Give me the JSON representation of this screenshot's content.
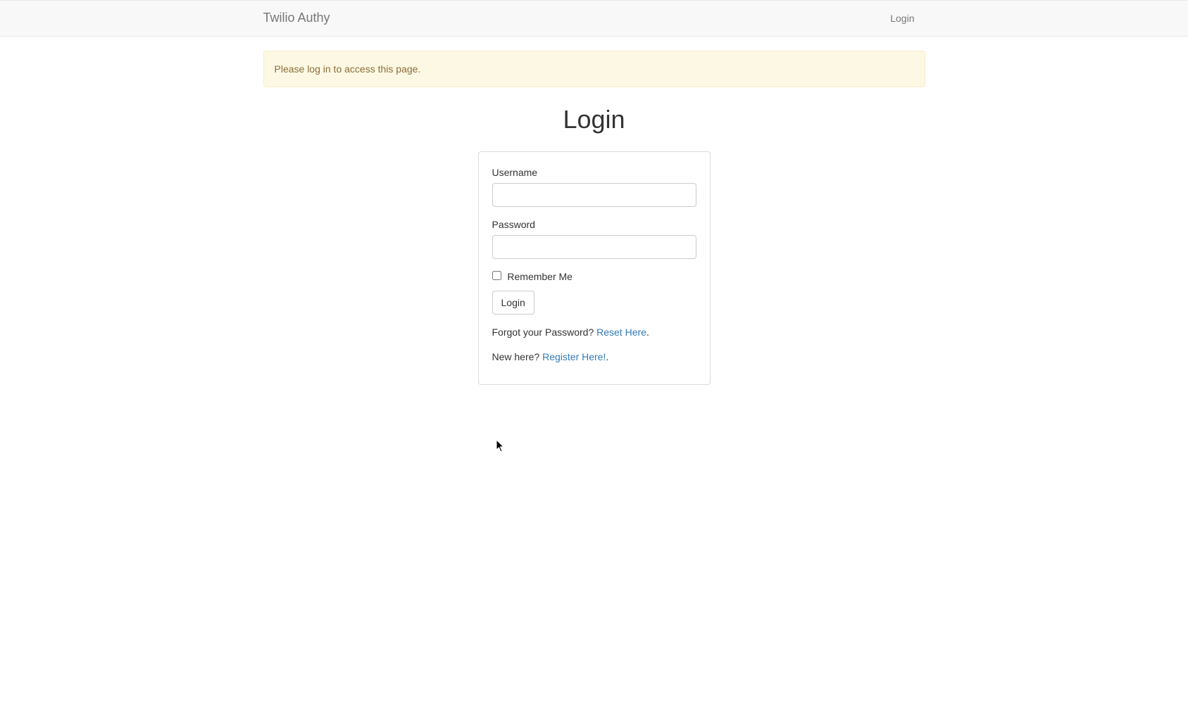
{
  "navbar": {
    "brand": "Twilio Authy",
    "login_link": "Login"
  },
  "alert": {
    "message": "Please log in to access this page."
  },
  "page": {
    "title": "Login"
  },
  "form": {
    "username_label": "Username",
    "username_value": "",
    "password_label": "Password",
    "password_value": "",
    "remember_label": "Remember Me",
    "submit_label": "Login"
  },
  "links": {
    "forgot_prefix": "Forgot your Password? ",
    "forgot_link": "Reset Here",
    "forgot_suffix": ".",
    "register_prefix": "New here? ",
    "register_link": "Register Here!",
    "register_suffix": "."
  }
}
